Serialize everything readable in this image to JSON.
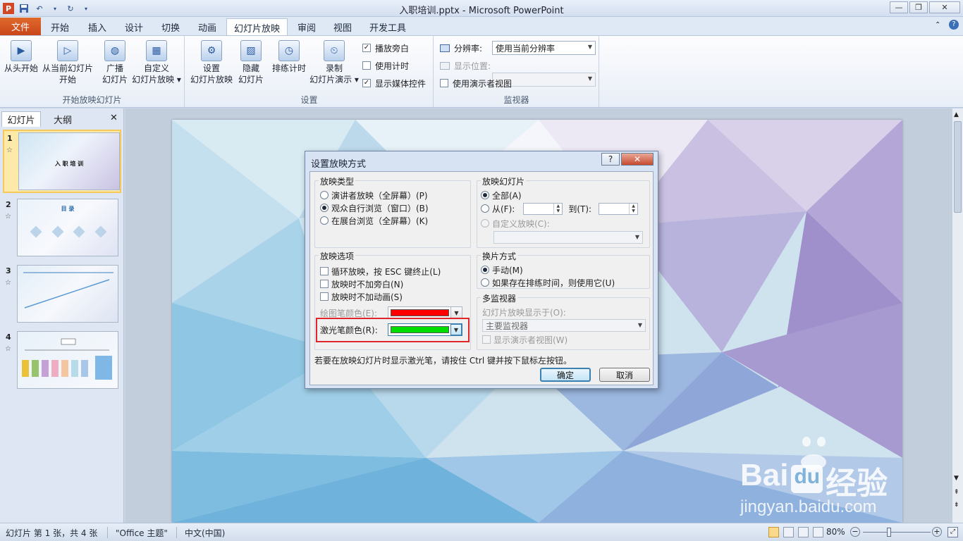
{
  "window": {
    "title": "入职培训.pptx - Microsoft PowerPoint",
    "minimize": "—",
    "restore": "❐",
    "close": "✕"
  },
  "qat": {
    "save_icon": "save-icon",
    "undo_icon": "undo-icon",
    "redo_icon": "redo-icon",
    "app_letter": "P"
  },
  "tabs": {
    "file": "文件",
    "items": [
      "开始",
      "插入",
      "设计",
      "切换",
      "动画",
      "幻灯片放映",
      "审阅",
      "视图",
      "开发工具"
    ],
    "active": "幻灯片放映"
  },
  "ribbon": {
    "group1": {
      "label": "开始放映幻灯片",
      "from_start": "从头开始",
      "from_current_1": "从当前幻灯片",
      "from_current_2": "开始",
      "broadcast_1": "广播",
      "broadcast_2": "幻灯片",
      "custom_1": "自定义",
      "custom_2": "幻灯片放映 ▾"
    },
    "group2": {
      "label": "设置",
      "setup_1": "设置",
      "setup_2": "幻灯片放映",
      "hide_1": "隐藏",
      "hide_2": "幻灯片",
      "rehearse": "排练计时",
      "record_1": "录制",
      "record_2": "幻灯片演示 ▾",
      "play_narration": "播放旁白",
      "use_timings": "使用计时",
      "show_media": "显示媒体控件"
    },
    "group3": {
      "label": "监视器",
      "resolution_label": "分辨率:",
      "resolution_value": "使用当前分辨率",
      "show_on_label": "显示位置:",
      "presenter_view": "使用演示者视图"
    },
    "help_icon": "?"
  },
  "leftpane": {
    "tab_slides": "幻灯片",
    "tab_outline": "大纲",
    "close": "✕",
    "thumbs": [
      {
        "num": "1",
        "text": "入 职 培 训"
      },
      {
        "num": "2",
        "text": "目 录"
      },
      {
        "num": "3",
        "text": ""
      },
      {
        "num": "4",
        "text": ""
      }
    ]
  },
  "dialog": {
    "title": "设置放映方式",
    "help": "?",
    "close": "✕",
    "show_type": {
      "title": "放映类型",
      "presenter": "演讲者放映（全屏幕）(P)",
      "individual": "观众自行浏览（窗口）(B)",
      "kiosk": "在展台浏览（全屏幕）(K)"
    },
    "show_slides": {
      "title": "放映幻灯片",
      "all": "全部(A)",
      "from": "从(F):",
      "to": "到(T):",
      "custom": "自定义放映(C):"
    },
    "show_options": {
      "title": "放映选项",
      "loop": "循环放映，按 ESC 键终止(L)",
      "no_narration": "放映时不加旁白(N)",
      "no_animation": "放映时不加动画(S)",
      "pen_color": "绘图笔颜色(E):",
      "laser_color": "激光笔颜色(R):"
    },
    "advance": {
      "title": "换片方式",
      "manual": "手动(M)",
      "timings": "如果存在排练时间，则使用它(U)"
    },
    "multi_monitor": {
      "title": "多监视器",
      "display_on": "幻灯片放映显示于(O):",
      "monitor_value": "主要监视器",
      "presenter_view": "显示演示者视图(W)"
    },
    "hint": "若要在放映幻灯片时显示激光笔，请按住 Ctrl 键并按下鼠标左按钮。",
    "ok": "确定",
    "cancel": "取消"
  },
  "status": {
    "slide_info": "幻灯片 第 1 张，共 4 张",
    "theme": "\"Office 主题\"",
    "language": "中文(中国)",
    "zoom": "80%"
  },
  "watermark": {
    "brand": "Bai",
    "brand2": "du",
    "cn": "经验",
    "url": "jingyan.baidu.com"
  },
  "colors": {
    "pen": "#ff0000",
    "laser": "#00dd00",
    "file_tab": "#d4551f",
    "highlight": "#e0262b"
  }
}
